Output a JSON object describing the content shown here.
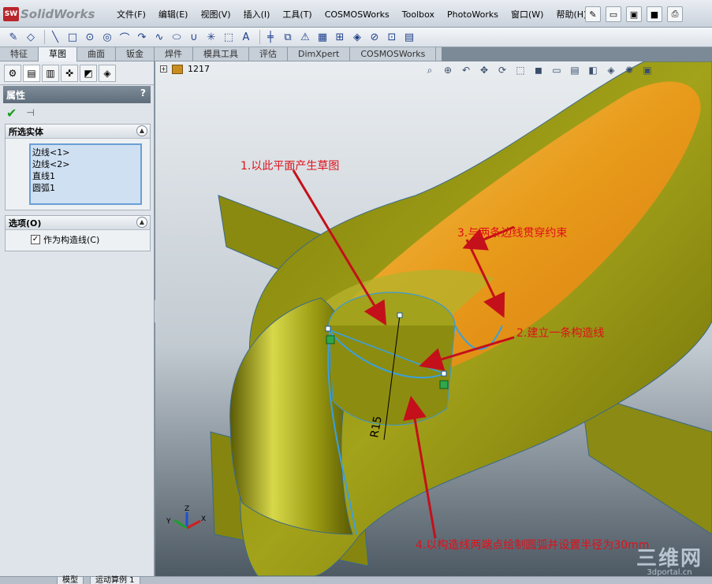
{
  "app": {
    "logo_text": "SolidWorks",
    "logo_badge": "SW"
  },
  "menu": [
    "文件(F)",
    "编辑(E)",
    "视图(V)",
    "插入(I)",
    "工具(T)",
    "COSMOSWorks",
    "Toolbox",
    "PhotoWorks",
    "窗口(W)",
    "帮助(H)"
  ],
  "tabs": [
    "特征",
    "草图",
    "曲面",
    "钣金",
    "焊件",
    "模具工具",
    "评估",
    "DimXpert",
    "COSMOSWorks"
  ],
  "active_tab": "草图",
  "panel": {
    "title": "属性",
    "help": "?",
    "selected_group": {
      "title": "所选实体",
      "items": [
        "边线<1>",
        "边线<2>",
        "直线1",
        "圆弧1"
      ]
    },
    "options_group": {
      "title": "选项(O)",
      "checkbox_label": "作为构造线(C)",
      "checked": true
    }
  },
  "viewport": {
    "part_label": "1217",
    "dimension": "R15",
    "callouts": {
      "c1": "1.以此平面产生草图",
      "c2": "2.建立一条构造线",
      "c3": "3.与两条边线贯穿约束",
      "c4": "4.以构造线两端点绘制圆弧并设置半径为30mm"
    },
    "triad": {
      "x": "X",
      "y": "Y",
      "z": "Z"
    }
  },
  "bottom_tabs": [
    "模型",
    "运动算例 1"
  ],
  "watermark": {
    "big": "三维网",
    "small": "3dportal.cn"
  },
  "colors": {
    "callout": "#e0101a",
    "sketch": "#3aa0e0",
    "body": "#8f8f12",
    "inner": "#e3a21d"
  }
}
